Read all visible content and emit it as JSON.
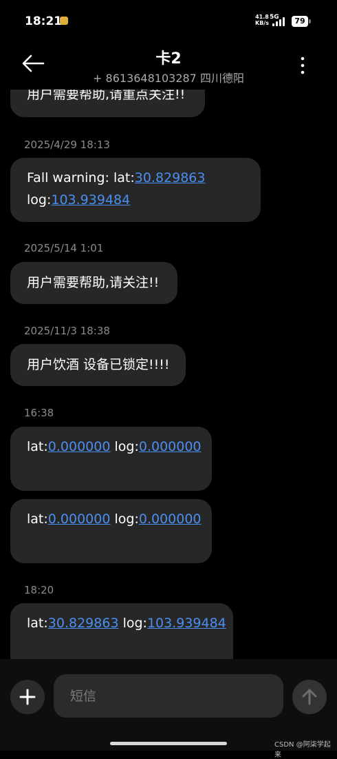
{
  "status_bar": {
    "time": "18:21",
    "net_speed_value": "41.8",
    "net_speed_unit": "KB/s",
    "network": "5G",
    "battery": "79"
  },
  "header": {
    "title": "卡2",
    "subtitle": "+ 8613648103287 四川德阳"
  },
  "messages": [
    {
      "timestamp": "",
      "parts": [
        {
          "text": "用户需要帮助,请重点关注!!",
          "link": false
        }
      ]
    },
    {
      "timestamp": "2025/4/29 18:13",
      "parts": [
        {
          "text": "Fall warning: lat:",
          "link": false
        },
        {
          "text": "30.829863",
          "link": true
        },
        {
          "text": "\nlog:",
          "link": false
        },
        {
          "text": "103.939484",
          "link": true
        }
      ]
    },
    {
      "timestamp": "2025/5/14 1:01",
      "parts": [
        {
          "text": "用户需要帮助,请关注!!",
          "link": false
        }
      ]
    },
    {
      "timestamp": "2025/11/3 18:38",
      "parts": [
        {
          "text": "用户饮酒 设备已锁定!!!!",
          "link": false
        }
      ]
    },
    {
      "timestamp": "16:38",
      "parts": [
        {
          "text": "lat:",
          "link": false
        },
        {
          "text": "0.000000",
          "link": true
        },
        {
          "text": " log:",
          "link": false
        },
        {
          "text": "0.000000",
          "link": true
        }
      ]
    },
    {
      "timestamp": "",
      "parts": [
        {
          "text": "lat:",
          "link": false
        },
        {
          "text": "0.000000",
          "link": true
        },
        {
          "text": " log:",
          "link": false
        },
        {
          "text": "0.000000",
          "link": true
        }
      ]
    },
    {
      "timestamp": "18:20",
      "parts": [
        {
          "text": "lat:",
          "link": false
        },
        {
          "text": "30.829863",
          "link": true
        },
        {
          "text": " log:",
          "link": false
        },
        {
          "text": "103.939484",
          "link": true
        }
      ]
    }
  ],
  "input": {
    "placeholder": "短信"
  },
  "watermark": "CSDN @阿柒学起来",
  "colors": {
    "background": "#000000",
    "bubble": "#272727",
    "link": "#4a8ff0",
    "timestamp": "#8b8b8b"
  },
  "icons": {
    "back": "arrow-left-icon",
    "more": "more-vertical-icon",
    "add": "plus-icon",
    "send": "arrow-up-icon"
  }
}
